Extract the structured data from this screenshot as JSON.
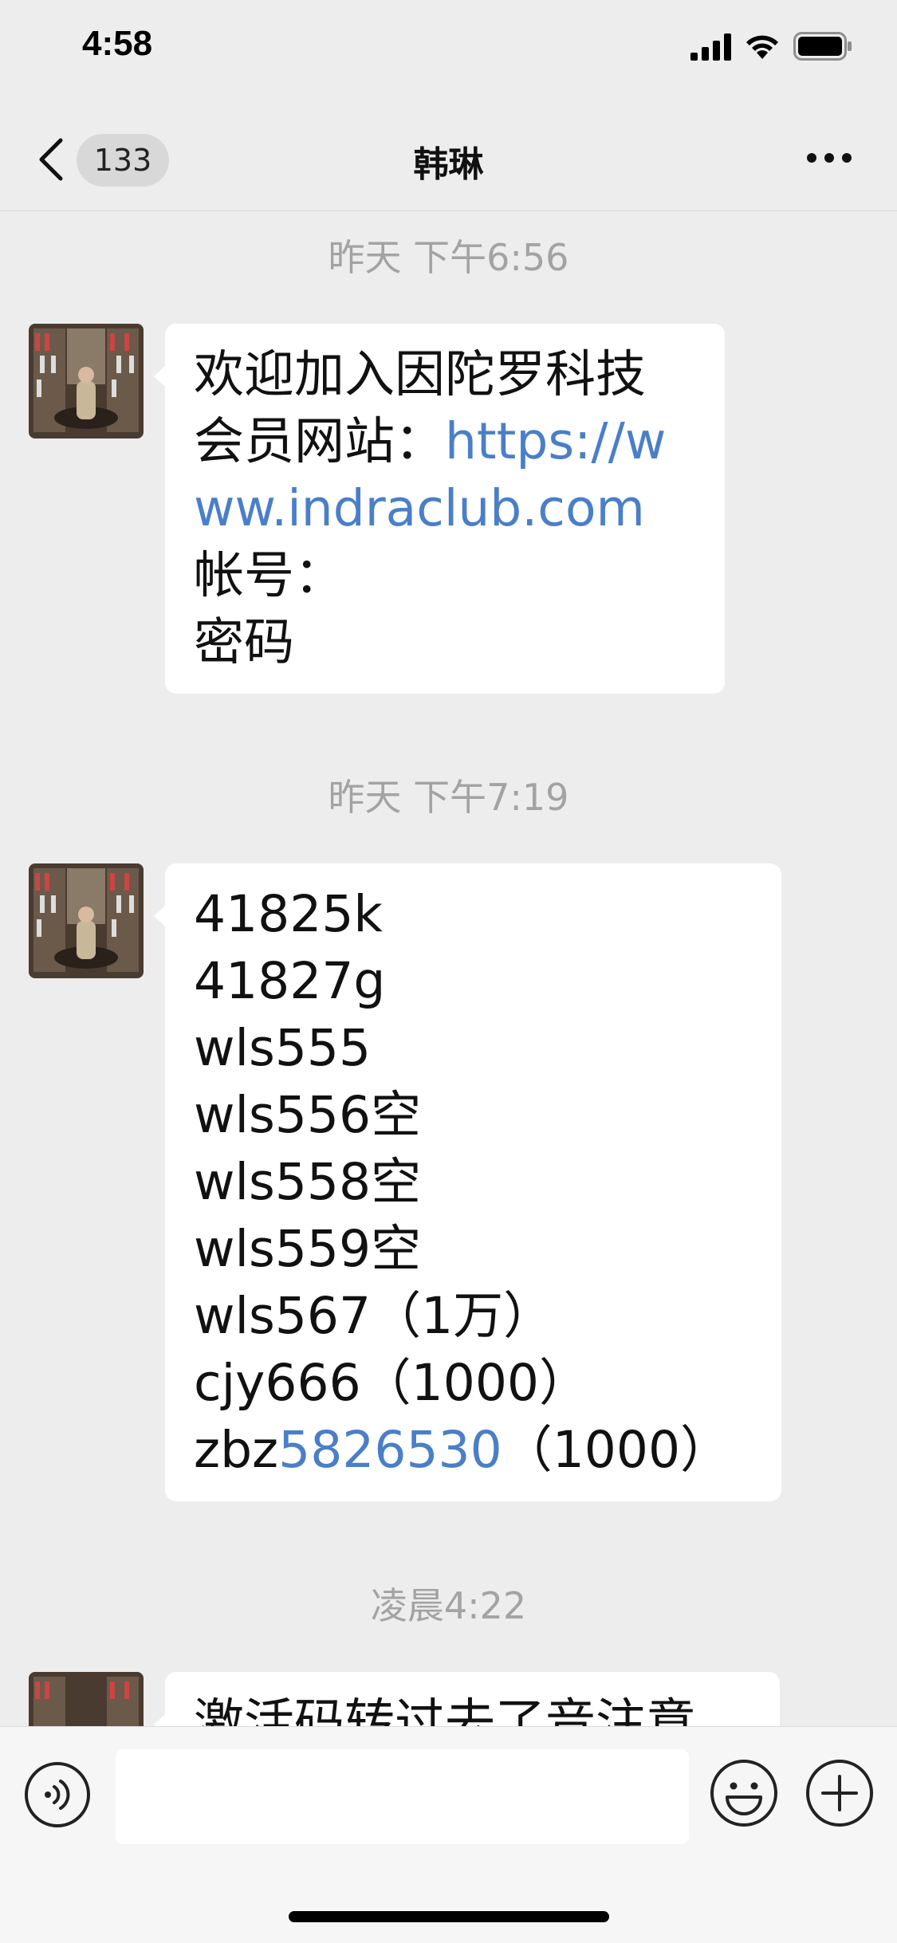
{
  "status_bar": {
    "time": "4:58"
  },
  "nav": {
    "unread_count": "133",
    "title": "韩琳"
  },
  "messages": [
    {
      "timestamp": "昨天 下午6:56",
      "lines": [
        {
          "text": "欢迎加入因陀罗科技"
        },
        {
          "prefix": "会员网站：",
          "link": "https://w"
        },
        {
          "link": "ww.indraclub.com"
        },
        {
          "text": "帐号："
        },
        {
          "text": "密码"
        }
      ]
    },
    {
      "timestamp": "昨天 下午7:19",
      "lines": [
        {
          "text": "41825k"
        },
        {
          "text": "41827g"
        },
        {
          "text": "wls555"
        },
        {
          "text": "wls556空"
        },
        {
          "text": "wls558空"
        },
        {
          "text": "wls559空"
        },
        {
          "text": "wls567（1万）"
        },
        {
          "text": "cjy666（1000）"
        },
        {
          "prefix": "zbz",
          "link": "5826530",
          "suffix": "（1000）"
        }
      ]
    },
    {
      "timestamp": "凌晨4:22",
      "lines": [
        {
          "text": "激活码转过去了音注意"
        }
      ]
    }
  ],
  "input": {
    "value": ""
  },
  "icons": {
    "back": "chevron-left-icon",
    "more": "more-dots-icon",
    "voice": "voice-icon",
    "emoji": "emoji-icon",
    "plus": "plus-icon"
  },
  "colors": {
    "link": "#4a7fc8",
    "background": "#ededed",
    "bubble": "#ffffff"
  }
}
